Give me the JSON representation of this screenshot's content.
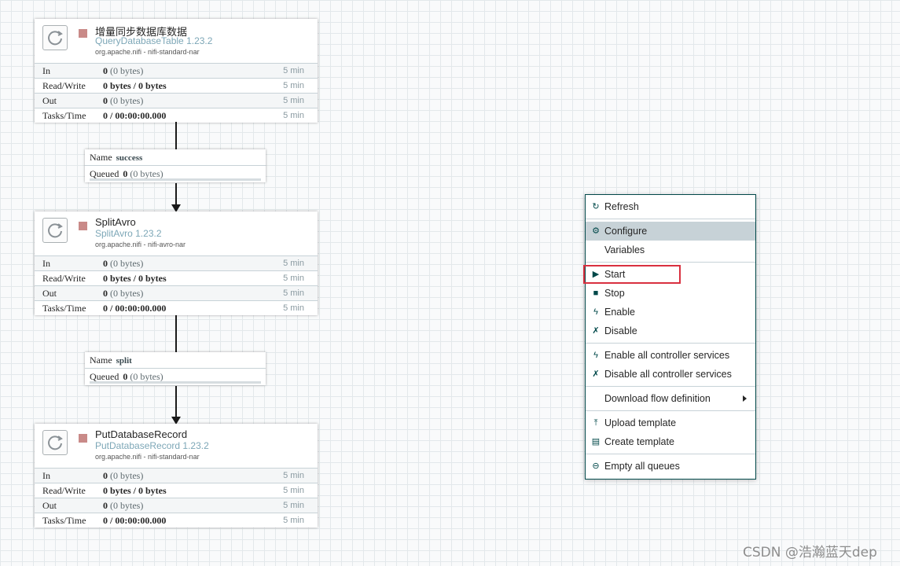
{
  "processors": [
    {
      "name": "增量同步数据库数据",
      "type": "QueryDatabaseTable 1.23.2",
      "bundle": "org.apache.nifi - nifi-standard-nar",
      "stats": [
        {
          "label": "In",
          "count": "0",
          "detail": "(0 bytes)",
          "time": "5 min"
        },
        {
          "label": "Read/Write",
          "count": "0 bytes / 0 bytes",
          "detail": "",
          "time": "5 min"
        },
        {
          "label": "Out",
          "count": "0",
          "detail": "(0 bytes)",
          "time": "5 min"
        },
        {
          "label": "Tasks/Time",
          "count": "0 / 00:00:00.000",
          "detail": "",
          "time": "5 min"
        }
      ]
    },
    {
      "name": "SplitAvro",
      "type": "SplitAvro 1.23.2",
      "bundle": "org.apache.nifi - nifi-avro-nar",
      "stats": [
        {
          "label": "In",
          "count": "0",
          "detail": "(0 bytes)",
          "time": "5 min"
        },
        {
          "label": "Read/Write",
          "count": "0 bytes / 0 bytes",
          "detail": "",
          "time": "5 min"
        },
        {
          "label": "Out",
          "count": "0",
          "detail": "(0 bytes)",
          "time": "5 min"
        },
        {
          "label": "Tasks/Time",
          "count": "0 / 00:00:00.000",
          "detail": "",
          "time": "5 min"
        }
      ]
    },
    {
      "name": "PutDatabaseRecord",
      "type": "PutDatabaseRecord 1.23.2",
      "bundle": "org.apache.nifi - nifi-standard-nar",
      "stats": [
        {
          "label": "In",
          "count": "0",
          "detail": "(0 bytes)",
          "time": "5 min"
        },
        {
          "label": "Read/Write",
          "count": "0 bytes / 0 bytes",
          "detail": "",
          "time": "5 min"
        },
        {
          "label": "Out",
          "count": "0",
          "detail": "(0 bytes)",
          "time": "5 min"
        },
        {
          "label": "Tasks/Time",
          "count": "0 / 00:00:00.000",
          "detail": "",
          "time": "5 min"
        }
      ]
    }
  ],
  "connections": [
    {
      "name_label": "Name",
      "name": "success",
      "queued_label": "Queued",
      "queued_count": "0",
      "queued_detail": "(0 bytes)"
    },
    {
      "name_label": "Name",
      "name": "split",
      "queued_label": "Queued",
      "queued_count": "0",
      "queued_detail": "(0 bytes)"
    }
  ],
  "context_menu": {
    "items": [
      {
        "label": "Refresh",
        "icon": "refresh-icon"
      },
      {
        "label": "Configure",
        "icon": "gear-icon",
        "hover": true
      },
      {
        "label": "Variables",
        "icon": ""
      },
      {
        "label": "Start",
        "icon": "play-icon",
        "highlighted": true
      },
      {
        "label": "Stop",
        "icon": "stop-icon"
      },
      {
        "label": "Enable",
        "icon": "bolt-icon"
      },
      {
        "label": "Disable",
        "icon": "disable-icon"
      },
      {
        "label": "Enable all controller services",
        "icon": "bolt-icon"
      },
      {
        "label": "Disable all controller services",
        "icon": "disable-icon"
      },
      {
        "label": "Download flow definition",
        "icon": "",
        "submenu": true
      },
      {
        "label": "Upload template",
        "icon": "upload-template-icon"
      },
      {
        "label": "Create template",
        "icon": "create-template-icon"
      },
      {
        "label": "Empty all queues",
        "icon": "minus-circle-icon"
      }
    ]
  },
  "colors": {
    "accent": "#004849",
    "highlight_box": "#d9303f",
    "stopped_state": "#c98a88"
  },
  "watermark": "CSDN @浩瀚蓝天dep"
}
